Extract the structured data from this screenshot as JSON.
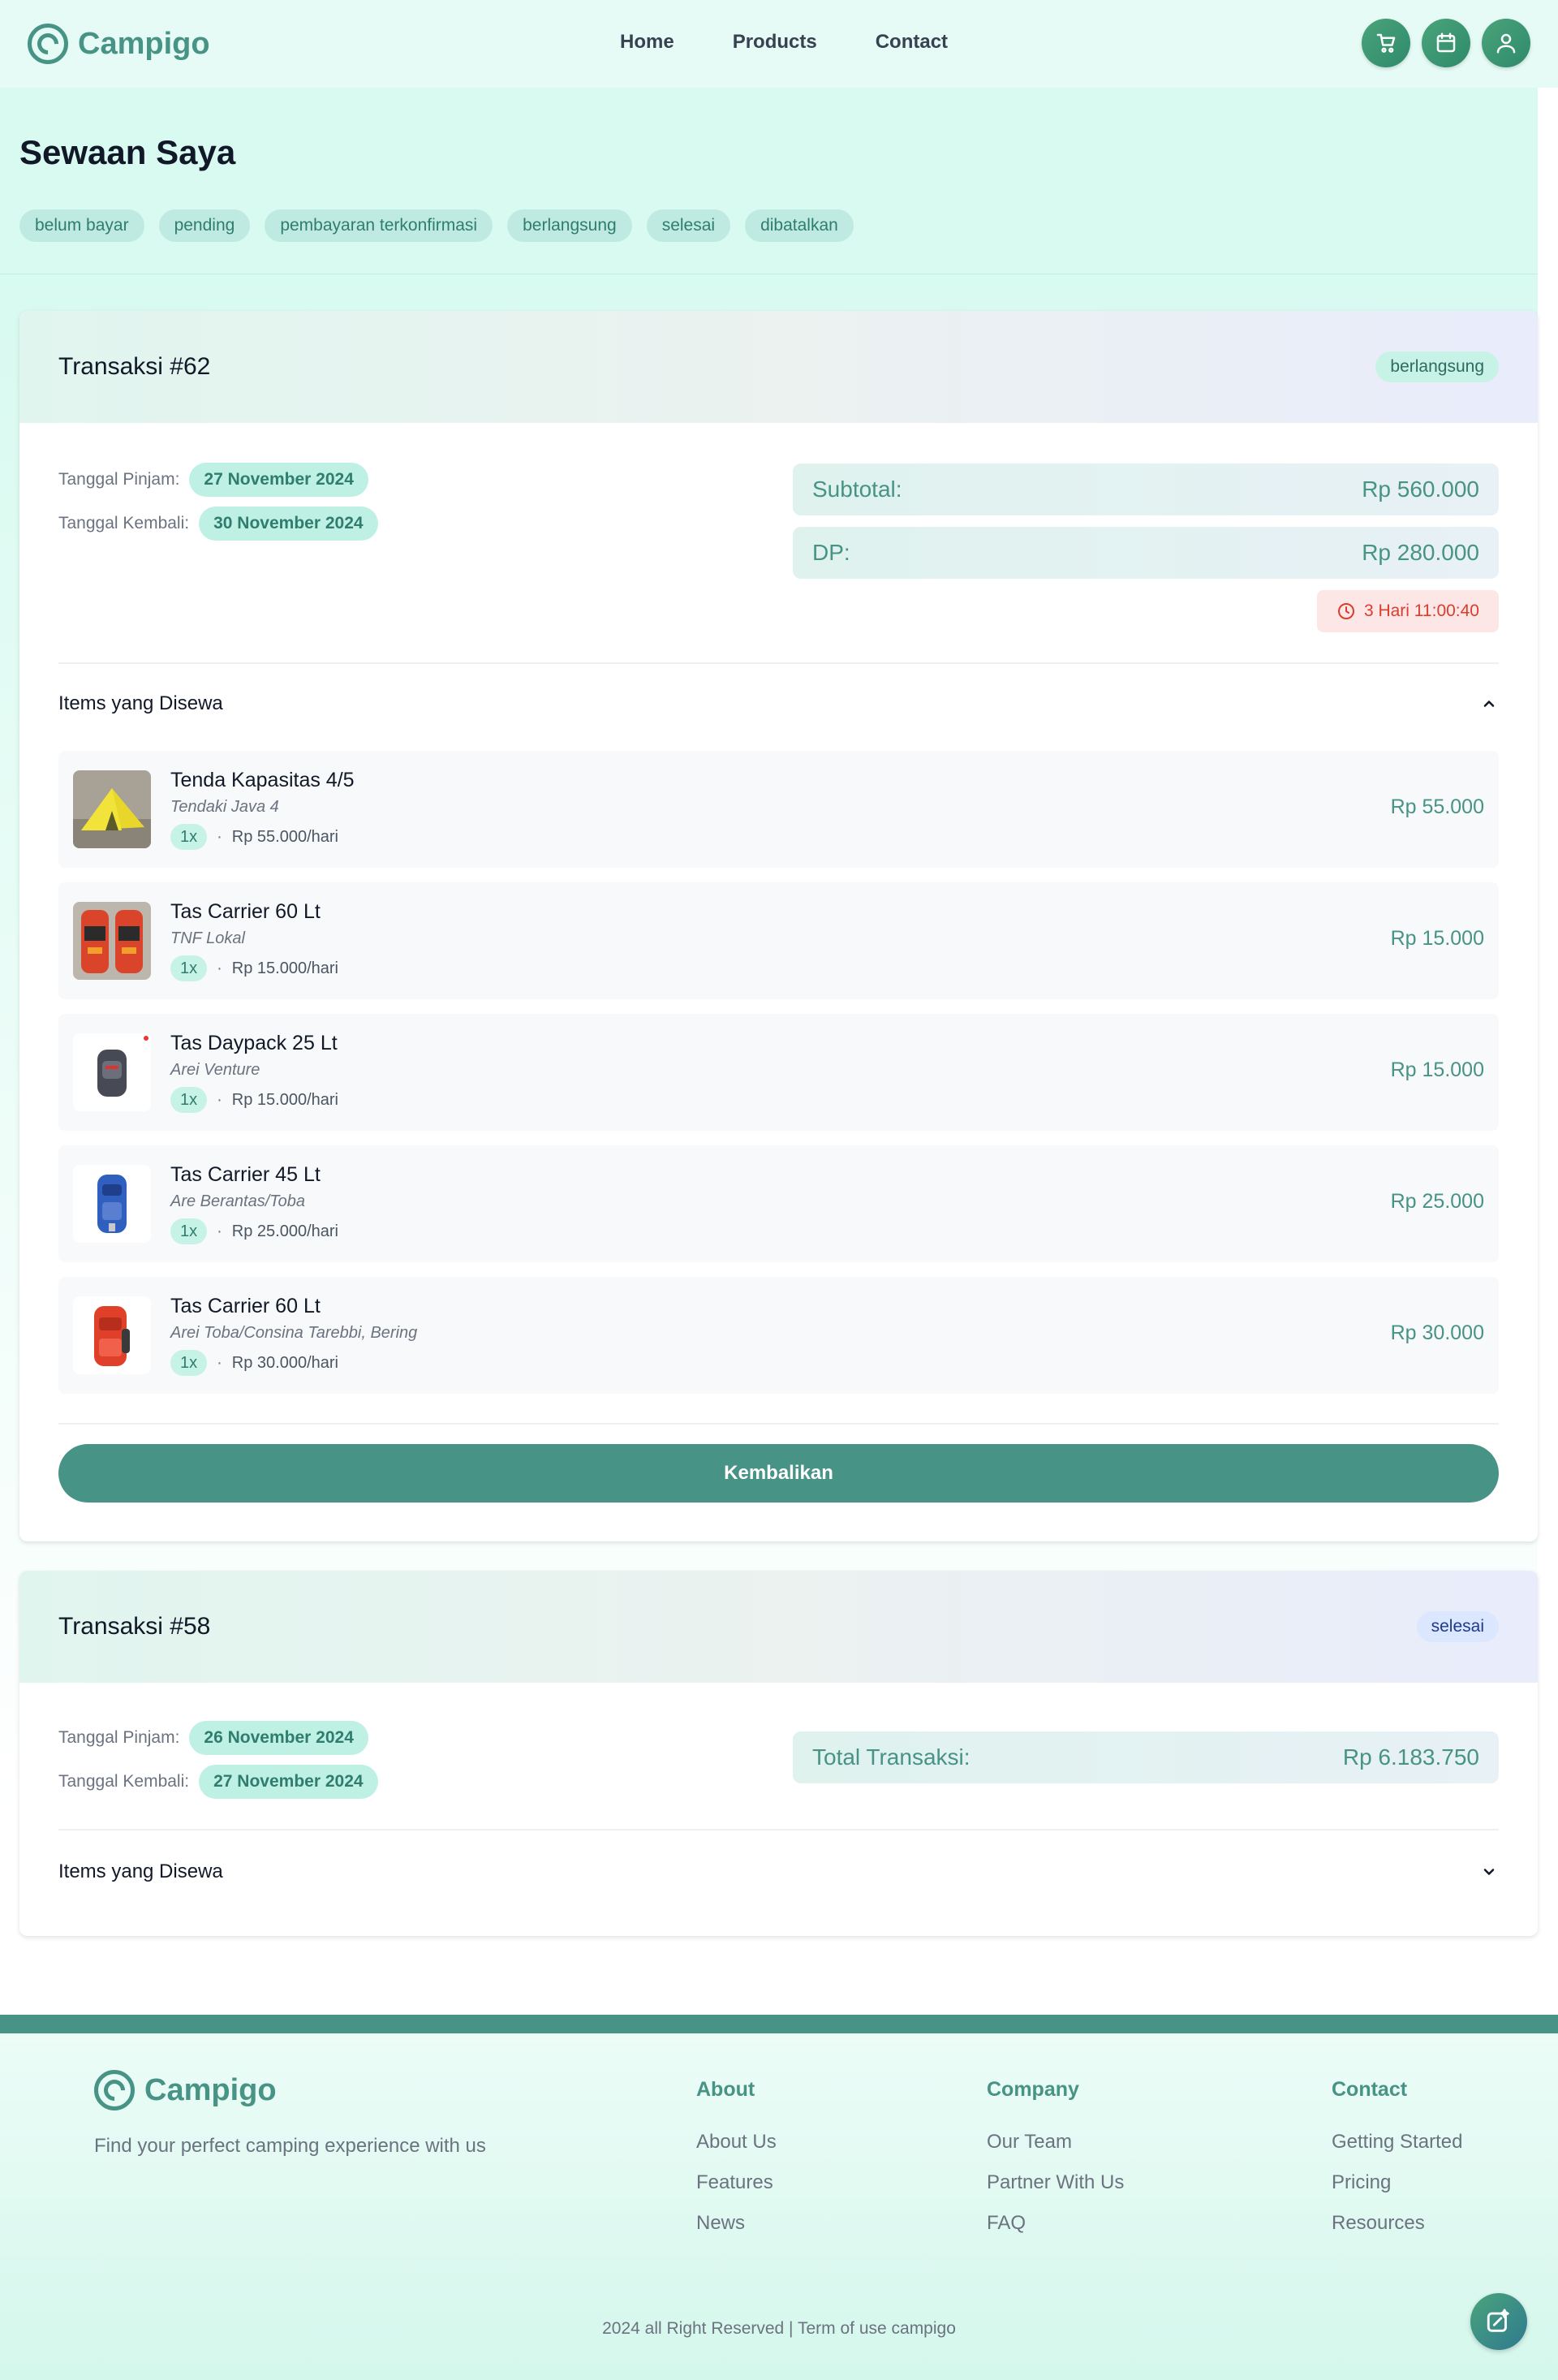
{
  "brand": {
    "name": "Campigo"
  },
  "nav": {
    "items": [
      "Home",
      "Products",
      "Contact"
    ]
  },
  "header_icons": [
    "cart-icon",
    "calendar-icon",
    "user-icon"
  ],
  "page": {
    "title": "Sewaan Saya",
    "filters": [
      "belum bayar",
      "pending",
      "pembayaran terkonfirmasi",
      "berlangsung",
      "selesai",
      "dibatalkan"
    ]
  },
  "transactions": [
    {
      "title": "Transaksi #62",
      "status": "berlangsung",
      "pinjam_label": "Tanggal Pinjam:",
      "pinjam": "27 November 2024",
      "kembali_label": "Tanggal Kembali:",
      "kembali": "30 November 2024",
      "subtotal_label": "Subtotal:",
      "subtotal": "Rp 560.000",
      "dp_label": "DP:",
      "dp": "Rp 280.000",
      "countdown": "3 Hari 11:00:40",
      "items_label": "Items yang Disewa",
      "items": [
        {
          "name": "Tenda Kapasitas 4/5",
          "brand": "Tendaki Java 4",
          "qty": "1x",
          "rate": "Rp 55.000/hari",
          "price": "Rp 55.000"
        },
        {
          "name": "Tas Carrier 60 Lt",
          "brand": "TNF Lokal",
          "qty": "1x",
          "rate": "Rp 15.000/hari",
          "price": "Rp 15.000"
        },
        {
          "name": "Tas Daypack 25 Lt",
          "brand": "Arei Venture",
          "qty": "1x",
          "rate": "Rp 15.000/hari",
          "price": "Rp 15.000"
        },
        {
          "name": "Tas Carrier 45 Lt",
          "brand": "Are Berantas/Toba",
          "qty": "1x",
          "rate": "Rp 25.000/hari",
          "price": "Rp 25.000"
        },
        {
          "name": "Tas Carrier 60 Lt",
          "brand": "Arei Toba/Consina Tarebbi, Bering",
          "qty": "1x",
          "rate": "Rp 30.000/hari",
          "price": "Rp 30.000"
        }
      ],
      "return_button": "Kembalikan"
    },
    {
      "title": "Transaksi #58",
      "status": "selesai",
      "pinjam_label": "Tanggal Pinjam:",
      "pinjam": "26 November 2024",
      "kembali_label": "Tanggal Kembali:",
      "kembali": "27 November 2024",
      "total_label": "Total Transaksi:",
      "total": "Rp 6.183.750",
      "items_label": "Items yang Disewa"
    }
  ],
  "footer": {
    "tagline": "Find your perfect camping experience with us",
    "columns": [
      {
        "title": "About",
        "links": [
          "About Us",
          "Features",
          "News"
        ]
      },
      {
        "title": "Company",
        "links": [
          "Our Team",
          "Partner With Us",
          "FAQ"
        ]
      },
      {
        "title": "Contact",
        "links": [
          "Getting Started",
          "Pricing",
          "Resources"
        ]
      }
    ],
    "copyright": "2024 all Right Reserved | Term of use campigo"
  },
  "colors": {
    "accent": "#479385",
    "danger": "#dc3c2c",
    "mint": "#d8faf0"
  }
}
